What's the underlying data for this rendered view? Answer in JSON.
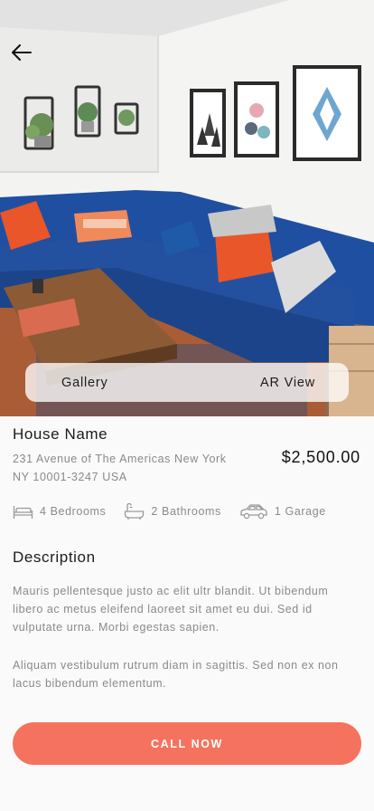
{
  "gallery": {
    "tabs": [
      "Gallery",
      "AR View"
    ]
  },
  "listing": {
    "name": "House Name",
    "address": "231 Avenue of The Americas New York NY 10001-3247 USA",
    "price": "$2,500.00"
  },
  "features": [
    {
      "icon": "bed-icon",
      "label": "4 Bedrooms"
    },
    {
      "icon": "bathtub-icon",
      "label": "2 Bathrooms"
    },
    {
      "icon": "car-icon",
      "label": "1 Garage"
    }
  ],
  "description": {
    "heading": "Description",
    "paragraphs": [
      "Mauris pellentesque justo ac elit ultr blandit. Ut bibendum libero ac metus eleifend laoreet sit amet eu dui. Sed id vulputate urna. Morbi egestas sapien.",
      "Aliquam vestibulum rutrum diam in sagittis. Sed non ex non lacus bibendum elementum."
    ]
  },
  "actions": {
    "call_label": "CALL NOW"
  },
  "colors": {
    "accent": "#f5735e",
    "sofa": "#1f4fa0",
    "pillow": "#e8562a"
  }
}
